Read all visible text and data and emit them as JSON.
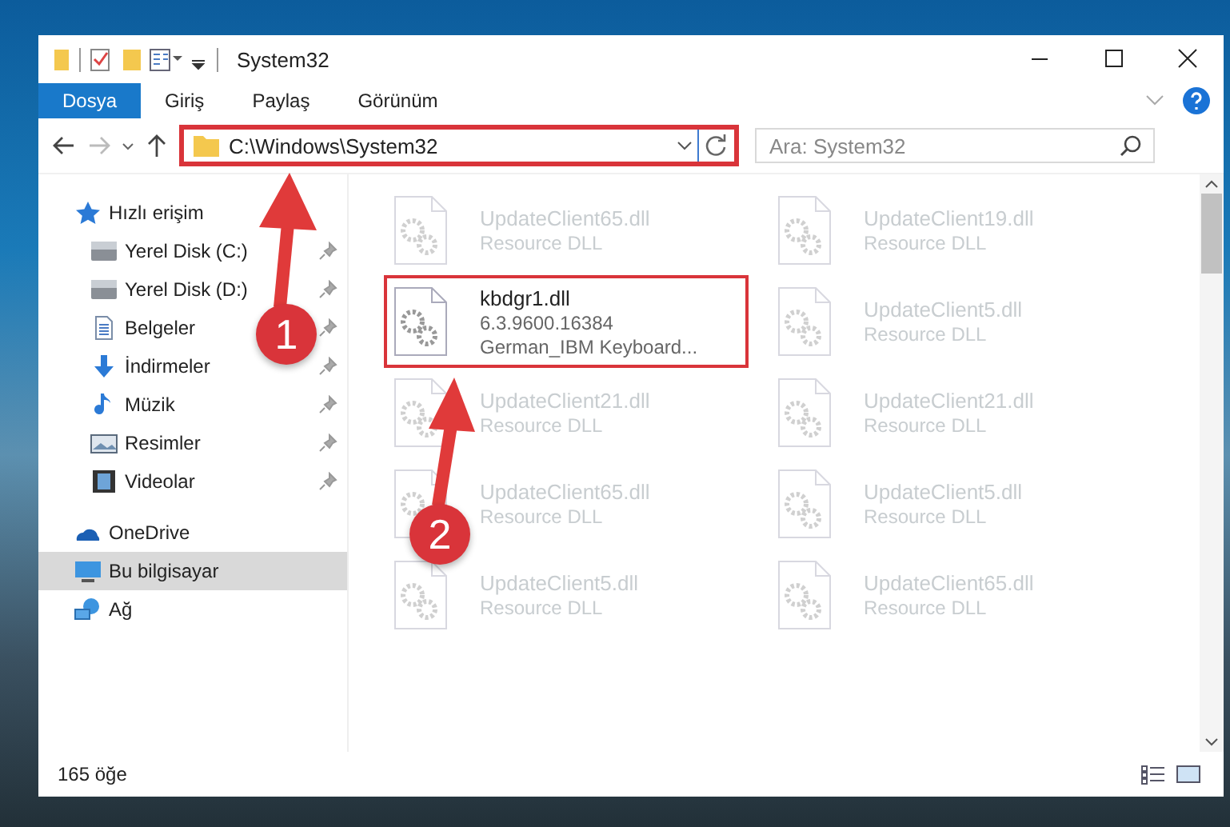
{
  "window": {
    "title": "System32"
  },
  "ribbon": {
    "tabs": [
      {
        "label": "Dosya",
        "selected": true
      },
      {
        "label": "Giriş",
        "selected": false
      },
      {
        "label": "Paylaş",
        "selected": false
      },
      {
        "label": "Görünüm",
        "selected": false
      }
    ]
  },
  "address": {
    "path": "C:\\Windows\\System32",
    "highlighted": true
  },
  "search": {
    "placeholder": "Ara: System32"
  },
  "sidebar": {
    "items": [
      {
        "label": "Hızlı erişim",
        "kind": "star",
        "pinned": false,
        "selected": false,
        "sub": false
      },
      {
        "label": "Yerel Disk (C:)",
        "kind": "drive",
        "pinned": true,
        "selected": false,
        "sub": true
      },
      {
        "label": "Yerel Disk (D:)",
        "kind": "drive",
        "pinned": true,
        "selected": false,
        "sub": true
      },
      {
        "label": "Belgeler",
        "kind": "document",
        "pinned": true,
        "selected": false,
        "sub": true
      },
      {
        "label": "İndirmeler",
        "kind": "download",
        "pinned": true,
        "selected": false,
        "sub": true
      },
      {
        "label": "Müzik",
        "kind": "music",
        "pinned": true,
        "selected": false,
        "sub": true
      },
      {
        "label": "Resimler",
        "kind": "picture",
        "pinned": true,
        "selected": false,
        "sub": true
      },
      {
        "label": "Videolar",
        "kind": "video",
        "pinned": true,
        "selected": false,
        "sub": true
      },
      {
        "label": "OneDrive",
        "kind": "cloud",
        "pinned": false,
        "selected": false,
        "sub": false
      },
      {
        "label": "Bu bilgisayar",
        "kind": "computer",
        "pinned": false,
        "selected": true,
        "sub": false
      },
      {
        "label": "Ağ",
        "kind": "network",
        "pinned": false,
        "selected": false,
        "sub": false
      }
    ]
  },
  "files": [
    {
      "name": "UpdateClient65.dll",
      "lines": [
        "Resource DLL"
      ],
      "faded": true,
      "highlighted": false
    },
    {
      "name": "UpdateClient19.dll",
      "lines": [
        "Resource DLL"
      ],
      "faded": true,
      "highlighted": false
    },
    {
      "name": "kbdgr1.dll",
      "lines": [
        "6.3.9600.16384",
        "German_IBM Keyboard..."
      ],
      "faded": false,
      "highlighted": true
    },
    {
      "name": "UpdateClient5.dll",
      "lines": [
        "Resource DLL"
      ],
      "faded": true,
      "highlighted": false
    },
    {
      "name": "UpdateClient21.dll",
      "lines": [
        "Resource DLL"
      ],
      "faded": true,
      "highlighted": false
    },
    {
      "name": "UpdateClient21.dll",
      "lines": [
        "Resource DLL"
      ],
      "faded": true,
      "highlighted": false
    },
    {
      "name": "UpdateClient65.dll",
      "lines": [
        "Resource DLL"
      ],
      "faded": true,
      "highlighted": false
    },
    {
      "name": "UpdateClient5.dll",
      "lines": [
        "Resource DLL"
      ],
      "faded": true,
      "highlighted": false
    },
    {
      "name": "UpdateClient5.dll",
      "lines": [
        "Resource DLL"
      ],
      "faded": true,
      "highlighted": false
    },
    {
      "name": "UpdateClient65.dll",
      "lines": [
        "Resource DLL"
      ],
      "faded": true,
      "highlighted": false
    }
  ],
  "annotations": [
    {
      "number": "1"
    },
    {
      "number": "2"
    }
  ],
  "status_bar": {
    "count": "165 öğe"
  }
}
